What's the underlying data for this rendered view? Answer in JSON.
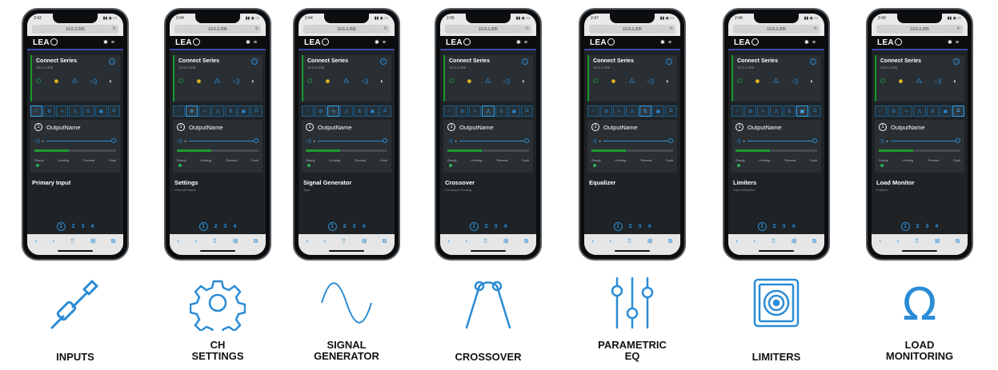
{
  "accent": "#2b8cd6",
  "phones": [
    {
      "time": "2:43",
      "url": "10.6.3.205",
      "device_title": "Connect Series",
      "device_ip": "10.6.3.205",
      "output_number": "1",
      "output_name": "OutputName",
      "active_tab": 0,
      "section_title": "Primary Input",
      "section_sub": "",
      "pages": [
        "1",
        "2",
        "3",
        "4"
      ]
    },
    {
      "time": "2:44",
      "url": "10.6.3.205",
      "device_title": "Connect Series",
      "device_ip": "10.6.3.205",
      "output_number": "1",
      "output_name": "OutputName",
      "active_tab": 1,
      "section_title": "Settings",
      "section_sub": "Channel Name",
      "pages": [
        "1",
        "2",
        "3",
        "4"
      ]
    },
    {
      "time": "2:44",
      "url": "10.6.3.205",
      "device_title": "Connect Series",
      "device_ip": "10.6.3.205",
      "output_number": "1",
      "output_name": "OutputName",
      "active_tab": 2,
      "section_title": "Signal Generator",
      "section_sub": "Type",
      "pages": [
        "1",
        "2",
        "3",
        "4"
      ]
    },
    {
      "time": "2:45",
      "url": "10.6.3.205",
      "device_title": "Connect Series",
      "device_ip": "10.6.3.205",
      "output_number": "1",
      "output_name": "OutputName",
      "active_tab": 3,
      "section_title": "Crossover",
      "section_sub": "Crossover Routing",
      "pages": [
        "1",
        "2",
        "3",
        "4"
      ]
    },
    {
      "time": "2:47",
      "url": "10.6.3.205",
      "device_title": "Connect Series",
      "device_ip": "10.6.3.205",
      "output_number": "1",
      "output_name": "OutputName",
      "active_tab": 4,
      "section_title": "Equalizer",
      "section_sub": "",
      "pages": [
        "1",
        "2",
        "3",
        "4"
      ]
    },
    {
      "time": "2:48",
      "url": "10.6.3.205",
      "device_title": "Connect Series",
      "device_ip": "10.6.3.205",
      "output_number": "1",
      "output_name": "OutputName",
      "active_tab": 5,
      "section_title": "Limiters",
      "section_sub": "Gain Reduction",
      "pages": [
        "1",
        "2",
        "3",
        "4"
      ]
    },
    {
      "time": "2:49",
      "url": "10.6.3.205",
      "device_title": "Connect Series",
      "device_ip": "10.6.3.205",
      "output_number": "1",
      "output_name": "OutputName",
      "active_tab": 6,
      "section_title": "Load Monitor",
      "section_sub": "Enabled",
      "pages": [
        "1",
        "2",
        "3",
        "4"
      ]
    }
  ],
  "common": {
    "logo": "LEA",
    "status_labels": [
      "Ready",
      "Limiting",
      "Thermal",
      "Fault"
    ]
  },
  "features": [
    {
      "label": "INPUTS",
      "icon": "plug-icon"
    },
    {
      "label": "CH\nSETTINGS",
      "icon": "gear-icon"
    },
    {
      "label": "SIGNAL\nGENERATOR",
      "icon": "sine-wave-icon"
    },
    {
      "label": "CROSSOVER",
      "icon": "crossover-icon"
    },
    {
      "label": "PARAMETRIC\nEQ",
      "icon": "eq-sliders-icon"
    },
    {
      "label": "LIMITERS",
      "icon": "speaker-limiter-icon"
    },
    {
      "label": "LOAD\nMONITORING",
      "icon": "omega-icon"
    }
  ]
}
